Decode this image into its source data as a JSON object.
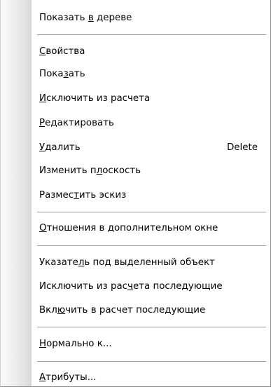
{
  "menu": {
    "items": [
      {
        "label": "Показать в дереве",
        "mnemonic": "в"
      },
      {
        "label": "Свойства",
        "mnemonic": "С"
      },
      {
        "label": "Показать",
        "mnemonic": "з"
      },
      {
        "label": "Исключить из расчета",
        "mnemonic": "И"
      },
      {
        "label": "Редактировать",
        "mnemonic": "Р"
      },
      {
        "label": "Удалить",
        "mnemonic": "У",
        "shortcut": "Delete"
      },
      {
        "label": "Изменить плоскость",
        "mnemonic": "л"
      },
      {
        "label": "Разместить эскиз",
        "mnemonic": "т"
      },
      {
        "label": "Отношения в дополнительном окне",
        "mnemonic": "О"
      },
      {
        "label": "Указатель под выделенный объект",
        "mnemonic": "л"
      },
      {
        "label": "Исключить из расчета последующие",
        "mnemonic": "ч"
      },
      {
        "label": "Включить в расчет последующие",
        "mnemonic": "ю"
      },
      {
        "label": "Нормально к...",
        "mnemonic": "Н"
      },
      {
        "label": "Атрибуты...",
        "mnemonic": "А"
      }
    ]
  }
}
